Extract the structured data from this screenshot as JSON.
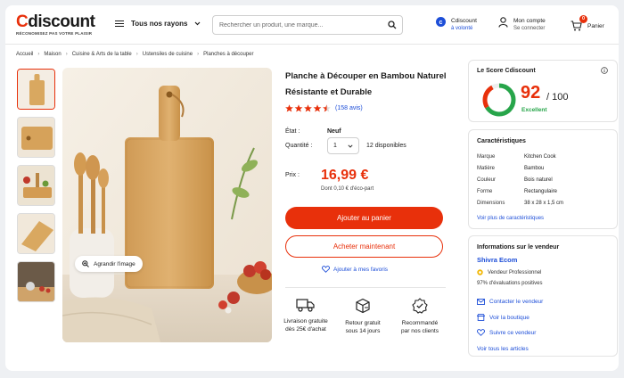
{
  "header": {
    "logo": "discount",
    "logo_c": "C",
    "tagline": "RÉCONOMISEZ PAS VOTRE PLAISIR",
    "menu_label": "Tous nos rayons",
    "search_placeholder": "Rechercher un produit, une marque...",
    "volonte_title": "Cdiscount",
    "volonte_sub": "à volonté",
    "account_title": "Mon compte",
    "account_sub": "Se connecter",
    "cart_label": "Panier",
    "cart_count": "0"
  },
  "breadcrumb": [
    "Accueil",
    "Maison",
    "Cuisine & Arts de la table",
    "Ustensiles de cuisine",
    "Planches à découper"
  ],
  "gallery": {
    "zoom_label": "Agrandir l'image"
  },
  "product": {
    "title": "Planche à Découper en Bambou Naturel Résistante et Durable",
    "rating_value": 4.5,
    "reviews": "(158 avis)",
    "etat_label": "État :",
    "etat_value": "Neuf",
    "qty_label": "Quantité :",
    "qty_value": "1",
    "stock": "12 disponibles",
    "price_label": "Prix :",
    "price": "16,99 €",
    "eco": "Dont 0,10 € d'éco-part",
    "add_to_cart": "Ajouter au panier",
    "buy_now": "Acheter maintenant",
    "favorite": "Ajouter à mes favoris"
  },
  "features": [
    {
      "icon": "truck-icon",
      "line1": "Livraison gratuite",
      "line2": "dès 25€ d'achat"
    },
    {
      "icon": "return-box-icon",
      "line1": "Retour gratuit",
      "line2": "sous 14 jours"
    },
    {
      "icon": "verified-badge-icon",
      "line1": "Recommandé",
      "line2": "par nos clients"
    }
  ],
  "score": {
    "title": "Le Score Cdiscount",
    "value": "92",
    "out_of": "/ 100",
    "ratio": 0.92,
    "label": "Excellent"
  },
  "specs": {
    "title": "Caractéristiques",
    "rows": [
      {
        "k": "Marque",
        "v": "Kitchen Cook"
      },
      {
        "k": "Matière",
        "v": "Bambou"
      },
      {
        "k": "Couleur",
        "v": "Bois naturel"
      },
      {
        "k": "Forme",
        "v": "Rectangulaire"
      },
      {
        "k": "Dimensions",
        "v": "38 x 28 x 1,5 cm"
      }
    ],
    "more": "Voir plus de caractéristiques"
  },
  "seller": {
    "title": "Informations sur le vendeur",
    "name": "Shivra Ecom",
    "pro": "Vendeur Professionnel",
    "positive": "97% d'évaluations positives",
    "contact": "Contacter le vendeur",
    "shop": "Voir la boutique",
    "follow": "Suivre ce vendeur",
    "all_items": "Voir tous les articles"
  },
  "colors": {
    "brand": "#e8300b",
    "link": "#1d4ed8",
    "good": "#27a54a"
  }
}
